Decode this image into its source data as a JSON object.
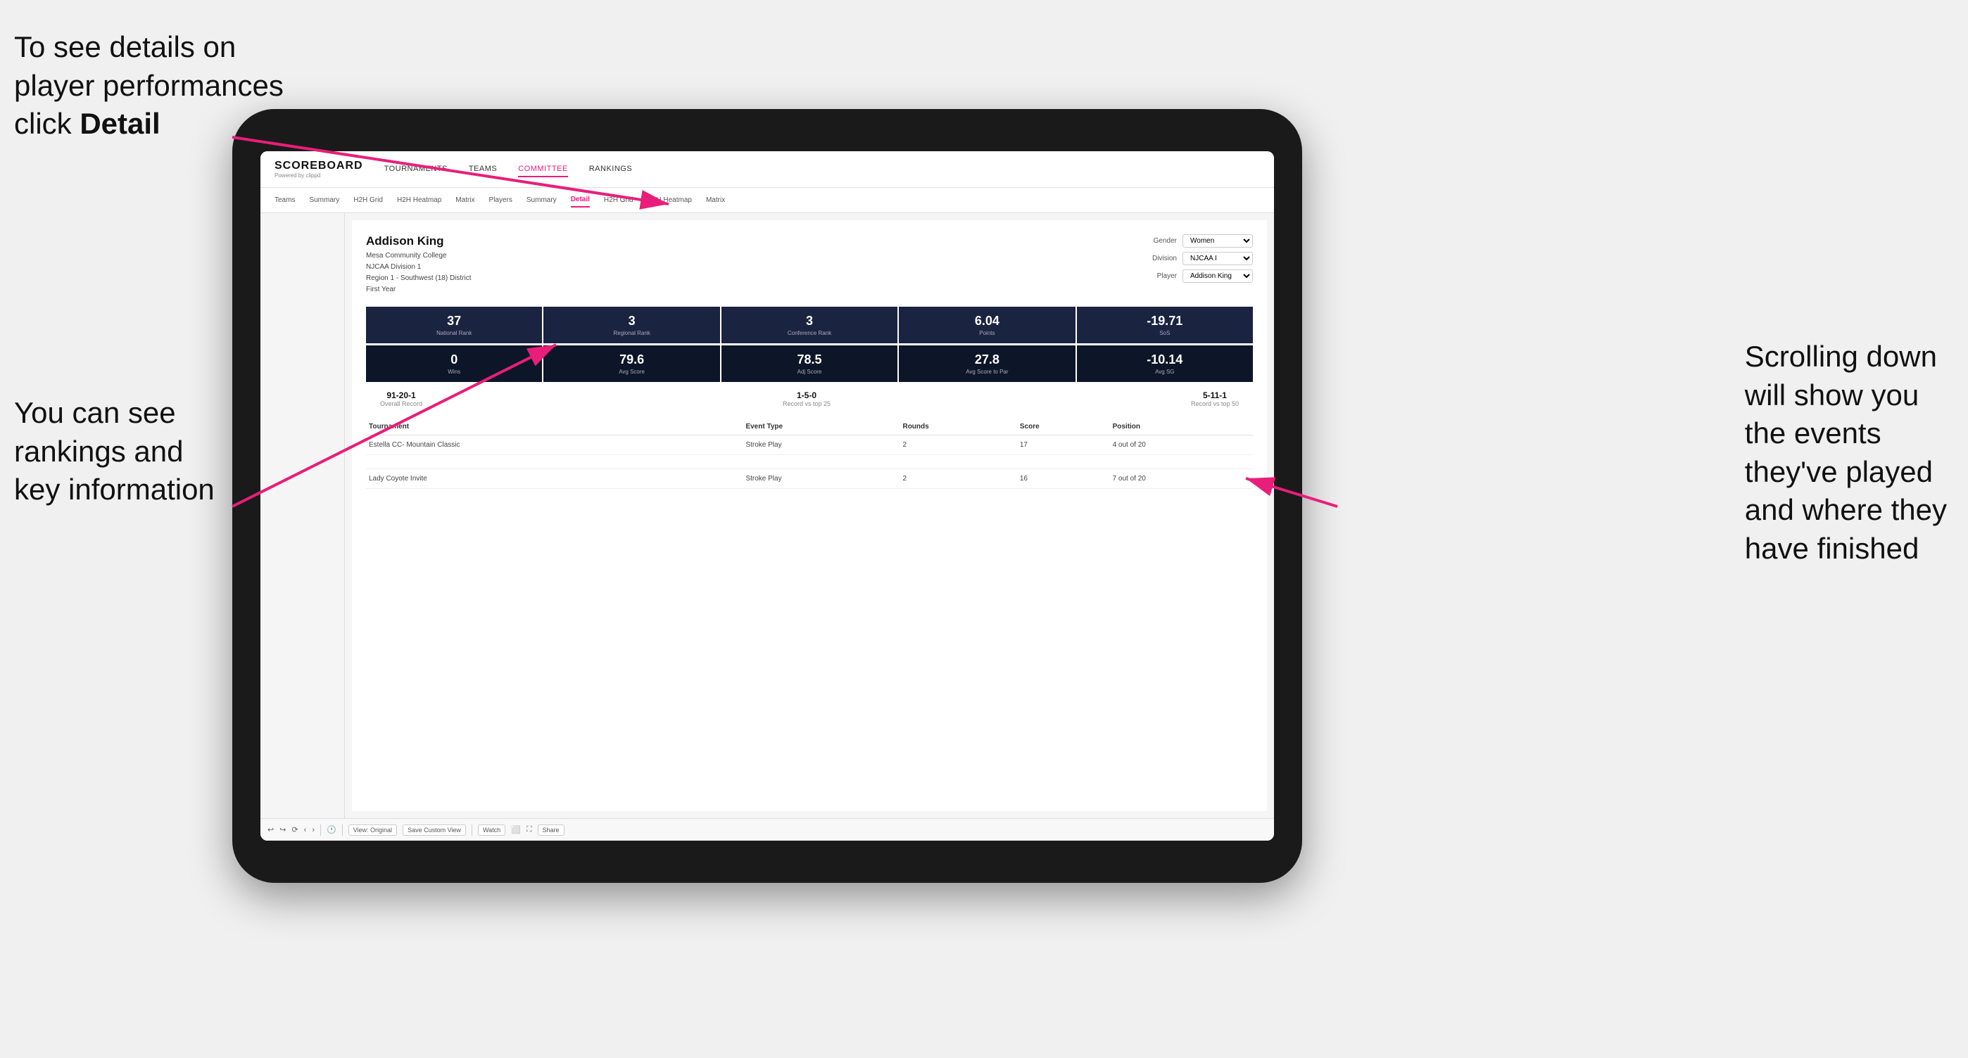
{
  "annotations": {
    "top_left_line1": "To see details on",
    "top_left_line2": "player performances",
    "top_left_line3_prefix": "click ",
    "top_left_line3_bold": "Detail",
    "bottom_left_line1": "You can see",
    "bottom_left_line2": "rankings and",
    "bottom_left_line3": "key information",
    "right_line1": "Scrolling down",
    "right_line2": "will show you",
    "right_line3": "the events",
    "right_line4": "they've played",
    "right_line5": "and where they",
    "right_line6": "have finished"
  },
  "nav": {
    "logo": "SCOREBOARD",
    "logo_sub": "Powered by clippd",
    "items": [
      {
        "label": "TOURNAMENTS",
        "active": false
      },
      {
        "label": "TEAMS",
        "active": false
      },
      {
        "label": "COMMITTEE",
        "active": true
      },
      {
        "label": "RANKINGS",
        "active": false
      }
    ]
  },
  "subnav": {
    "items": [
      {
        "label": "Teams",
        "active": false
      },
      {
        "label": "Summary",
        "active": false
      },
      {
        "label": "H2H Grid",
        "active": false
      },
      {
        "label": "H2H Heatmap",
        "active": false
      },
      {
        "label": "Matrix",
        "active": false
      },
      {
        "label": "Players",
        "active": false
      },
      {
        "label": "Summary",
        "active": false
      },
      {
        "label": "Detail",
        "active": true
      },
      {
        "label": "H2H Grid",
        "active": false
      },
      {
        "label": "H2H Heatmap",
        "active": false
      },
      {
        "label": "Matrix",
        "active": false
      }
    ]
  },
  "player": {
    "name": "Addison King",
    "school": "Mesa Community College",
    "division": "NJCAA Division 1",
    "region": "Region 1 - Southwest (18) District",
    "year": "First Year"
  },
  "filters": {
    "gender_label": "Gender",
    "gender_value": "Women",
    "division_label": "Division",
    "division_value": "NJCAA I",
    "player_label": "Player",
    "player_value": "Addison King"
  },
  "stats_row1": [
    {
      "value": "37",
      "label": "National Rank"
    },
    {
      "value": "3",
      "label": "Regional Rank"
    },
    {
      "value": "3",
      "label": "Conference Rank"
    },
    {
      "value": "6.04",
      "label": "Points"
    },
    {
      "value": "-19.71",
      "label": "SoS"
    }
  ],
  "stats_row2": [
    {
      "value": "0",
      "label": "Wins"
    },
    {
      "value": "79.6",
      "label": "Avg Score"
    },
    {
      "value": "78.5",
      "label": "Adj Score"
    },
    {
      "value": "27.8",
      "label": "Avg Score to Par"
    },
    {
      "value": "-10.14",
      "label": "Avg SG"
    }
  ],
  "records": [
    {
      "value": "91-20-1",
      "label": "Overall Record"
    },
    {
      "value": "1-5-0",
      "label": "Record vs top 25"
    },
    {
      "value": "5-11-1",
      "label": "Record vs top 50"
    }
  ],
  "table": {
    "headers": [
      "Tournament",
      "",
      "Event Type",
      "Rounds",
      "Score",
      "Position"
    ],
    "rows": [
      {
        "tournament": "Estella CC- Mountain Classic",
        "event_type": "Stroke Play",
        "rounds": "2",
        "score": "17",
        "position": "4 out of 20"
      },
      {
        "tournament": "Lady Coyote Invite",
        "event_type": "Stroke Play",
        "rounds": "2",
        "score": "16",
        "position": "7 out of 20"
      }
    ]
  },
  "toolbar": {
    "view_label": "View: Original",
    "save_label": "Save Custom View",
    "watch_label": "Watch",
    "share_label": "Share"
  }
}
